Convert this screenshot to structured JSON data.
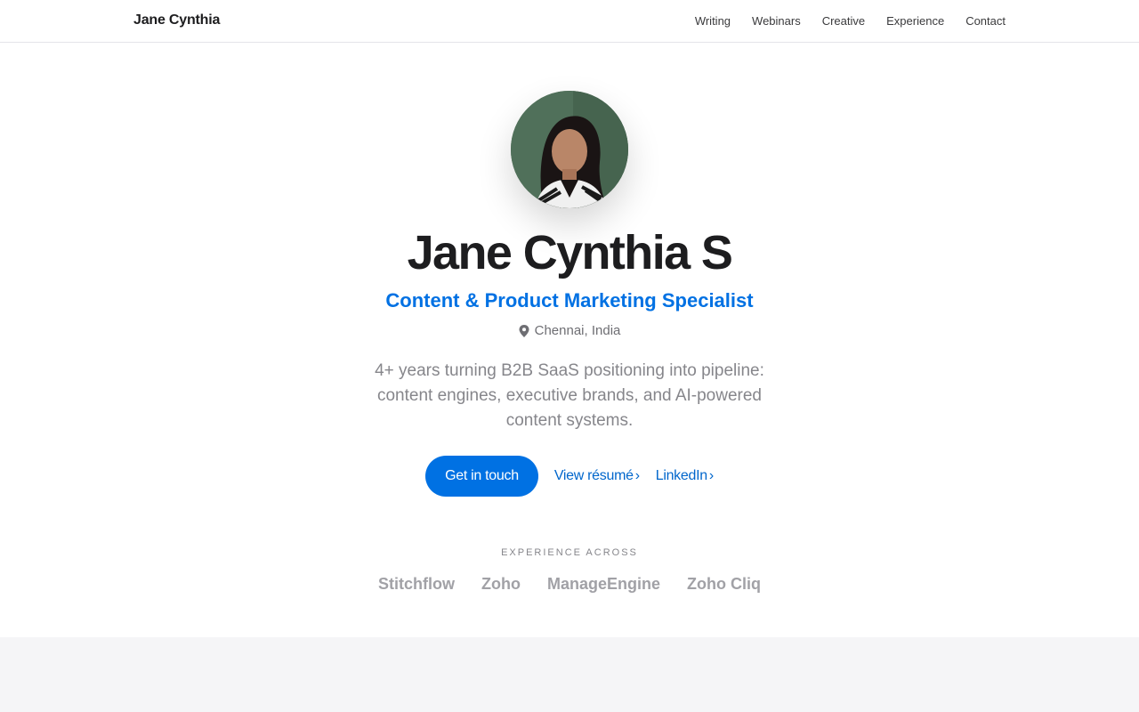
{
  "header": {
    "brand": "Jane Cynthia",
    "nav": [
      "Writing",
      "Webinars",
      "Creative",
      "Experience",
      "Contact"
    ]
  },
  "hero": {
    "name": "Jane Cynthia S",
    "role": "Content & Product Marketing Specialist",
    "location": "Chennai, India",
    "bio": "4+ years turning B2B SaaS positioning into pipeline: content engines, executive brands, and AI-powered content systems.",
    "primary_cta": "Get in touch",
    "resume_link": "View résumé",
    "linkedin_link": "LinkedIn",
    "chevron": "›"
  },
  "experience": {
    "label": "EXPERIENCE ACROSS",
    "companies": [
      "Stitchflow",
      "Zoho",
      "ManageEngine",
      "Zoho Cliq"
    ]
  },
  "colors": {
    "accent": "#0071e3",
    "text": "#1d1d1f",
    "muted": "#86868b",
    "band": "#f5f5f7"
  }
}
